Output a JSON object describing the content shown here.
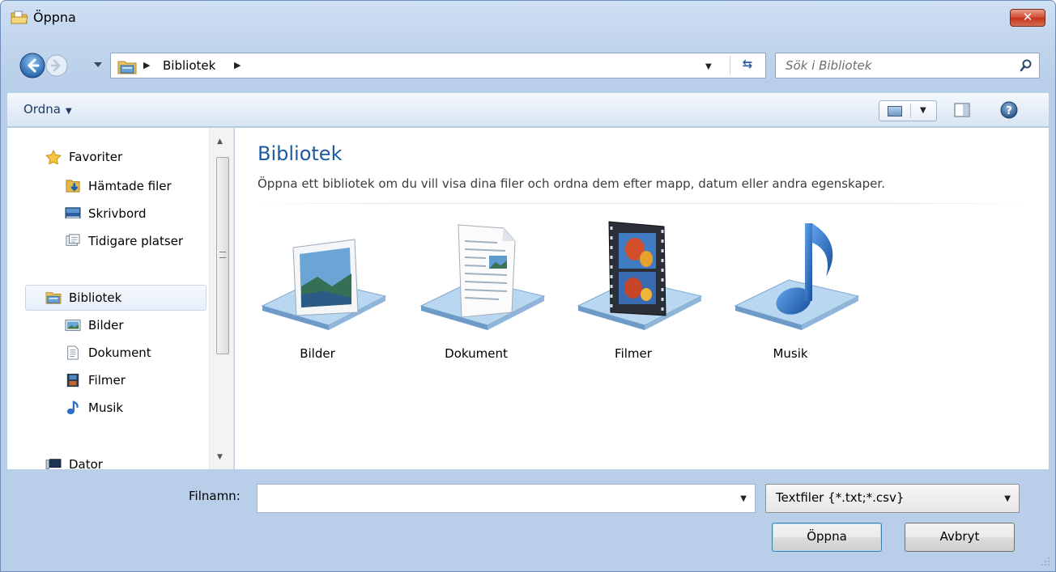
{
  "window": {
    "title": "Öppna",
    "close_label": "✕"
  },
  "address": {
    "breadcrumb": "Bibliotek",
    "search_placeholder": "Sök i Bibliotek"
  },
  "toolbar": {
    "organize_label": "Ordna",
    "organize_caret": "▼"
  },
  "navigation": {
    "favorites": {
      "header": "Favoriter",
      "items": [
        {
          "label": "Hämtade filer",
          "icon": "downloads-icon"
        },
        {
          "label": "Skrivbord",
          "icon": "desktop-icon"
        },
        {
          "label": "Tidigare platser",
          "icon": "recent-places-icon"
        }
      ]
    },
    "libraries": {
      "header": "Bibliotek",
      "items": [
        {
          "label": "Bilder",
          "icon": "pictures-icon"
        },
        {
          "label": "Dokument",
          "icon": "documents-icon"
        },
        {
          "label": "Filmer",
          "icon": "videos-icon"
        },
        {
          "label": "Musik",
          "icon": "music-icon"
        }
      ]
    },
    "computer": {
      "header": "Dator"
    }
  },
  "content": {
    "title": "Bibliotek",
    "description": "Öppna ett bibliotek om du vill visa dina filer och ordna dem efter mapp, datum eller andra egenskaper.",
    "libraries": [
      {
        "label": "Bilder",
        "icon": "pictures-library-icon"
      },
      {
        "label": "Dokument",
        "icon": "documents-library-icon"
      },
      {
        "label": "Filmer",
        "icon": "videos-library-icon"
      },
      {
        "label": "Musik",
        "icon": "music-library-icon"
      }
    ]
  },
  "bottom": {
    "filename_label": "Filnamn:",
    "filename_value": "",
    "filter_value": "Textfiler {*.txt;*.csv}",
    "open_label": "Öppna",
    "cancel_label": "Avbryt"
  },
  "colors": {
    "title_accent": "#1e5aa0",
    "close_button": "#c4341a",
    "frame": "#c3d6ee"
  }
}
